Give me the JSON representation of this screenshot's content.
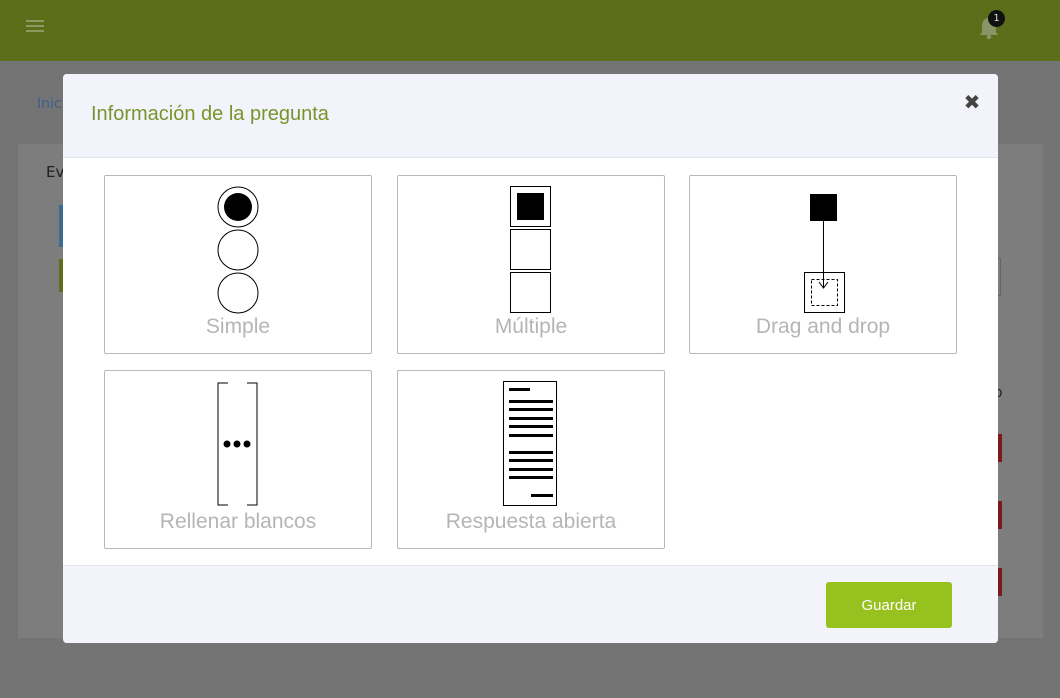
{
  "header": {
    "notifications_count": "1"
  },
  "background": {
    "breadcrumb": "Inic",
    "card_title": "Ev",
    "column_letter": "o"
  },
  "modal": {
    "title": "Información de la pregunta",
    "close_glyph": "✖",
    "save_label": "Guardar",
    "options": [
      {
        "label": "Simple",
        "icon": "radio-list-icon"
      },
      {
        "label": "Múltiple",
        "icon": "checkbox-list-icon"
      },
      {
        "label": "Drag and drop",
        "icon": "drag-drop-icon"
      },
      {
        "label": "Rellenar blancos",
        "icon": "fill-blanks-icon"
      },
      {
        "label": "Respuesta abierta",
        "icon": "open-answer-icon"
      }
    ]
  },
  "colors": {
    "accent": "#97c11f",
    "title": "#78942a",
    "topbar": "#5d6e1b"
  }
}
